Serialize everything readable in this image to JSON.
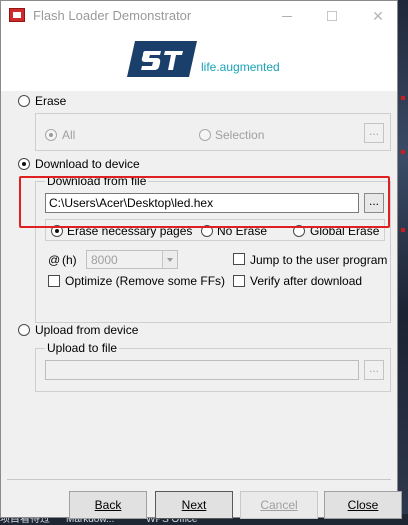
{
  "window": {
    "title": "Flash Loader Demonstrator"
  },
  "header": {
    "logo_text": "ST",
    "tagline": "life.augmented",
    "brand_color": "#1a3f6b",
    "tagline_color": "#1aa3b8"
  },
  "erase": {
    "label": "Erase",
    "selected": false,
    "options": {
      "all": "All",
      "selection": "Selection"
    },
    "browse_label": "..."
  },
  "download": {
    "label": "Download to device",
    "selected": true,
    "group_label": "Download from file",
    "file_path": "C:\\Users\\Acer\\Desktop\\led.hex",
    "browse_label": "...",
    "erase_modes": {
      "necessary": "Erase necessary pages",
      "none": "No Erase",
      "global": "Global Erase",
      "selected": "necessary"
    },
    "address_prefix": "@",
    "address_unit": "(h)",
    "address_value": "8000",
    "jump_to_user": "Jump to the user program",
    "optimize": "Optimize (Remove some FFs)",
    "verify": "Verify after download",
    "highlight_color": "#e02020"
  },
  "upload": {
    "label": "Upload from device",
    "selected": false,
    "group_label": "Upload to file",
    "file_path": "",
    "browse_label": "..."
  },
  "buttons": {
    "back": "Back",
    "next": "Next",
    "cancel": "Cancel",
    "close": "Close"
  },
  "taskbar": {
    "item1": "项目看待过",
    "item2": "Markdow...",
    "item3": "WPS Office"
  }
}
